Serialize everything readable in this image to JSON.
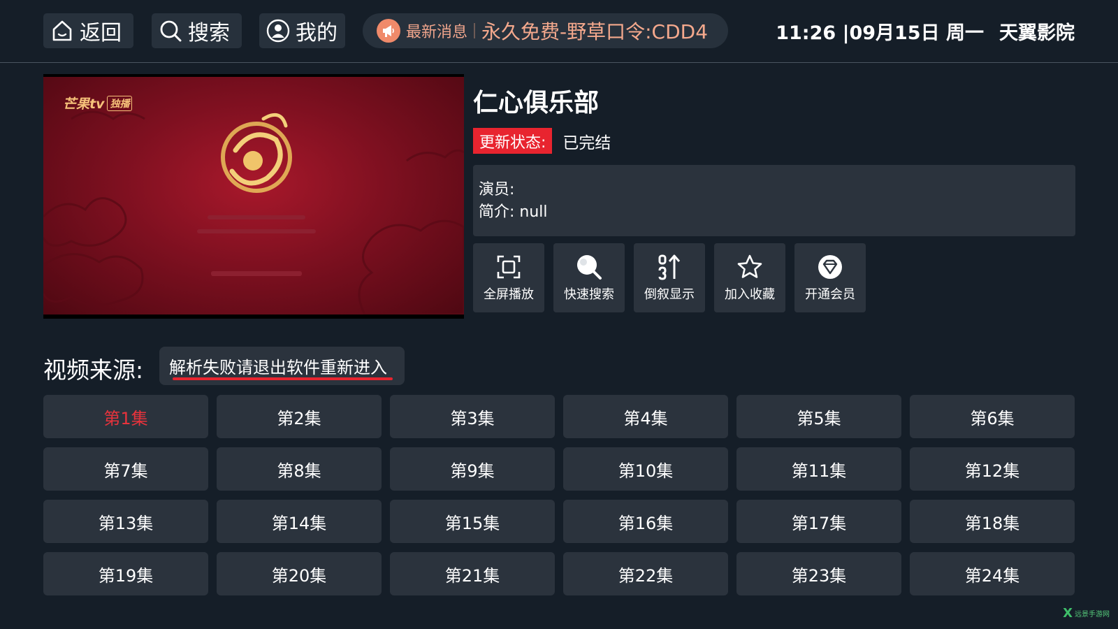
{
  "nav": {
    "back_label": "返回",
    "search_label": "搜索",
    "mine_label": "我的"
  },
  "news": {
    "label": "最新消息",
    "text": "永久免费-野草口令:CDD4"
  },
  "status_bar": {
    "datetime": "11:26 |09月15日 周一",
    "app_name": "天翼影院"
  },
  "poster": {
    "brand": "芒果tv",
    "badge": "独播"
  },
  "detail": {
    "title": "仁心俱乐部",
    "status_label": "更新状态:",
    "status_value": "已完结",
    "actors": "演员:",
    "intro": "简介:  null"
  },
  "actions": [
    {
      "label": "全屏播放",
      "icon": "fullscreen-icon"
    },
    {
      "label": "快速搜索",
      "icon": "search-icon"
    },
    {
      "label": "倒叙显示",
      "icon": "sort-icon"
    },
    {
      "label": "加入收藏",
      "icon": "star-icon"
    },
    {
      "label": "开通会员",
      "icon": "diamond-icon"
    }
  ],
  "source": {
    "label": "视频来源:",
    "value": "解析失败请退出软件重新进入"
  },
  "episodes": [
    "第1集",
    "第2集",
    "第3集",
    "第4集",
    "第5集",
    "第6集",
    "第7集",
    "第8集",
    "第9集",
    "第10集",
    "第11集",
    "第12集",
    "第13集",
    "第14集",
    "第15集",
    "第16集",
    "第17集",
    "第18集",
    "第19集",
    "第20集",
    "第21集",
    "第22集",
    "第23集",
    "第24集"
  ],
  "watermark": "远景手游网",
  "colors": {
    "background": "#151e28",
    "panel": "#2b333d",
    "accent_red": "#e8242f",
    "news_text": "#f5a98d"
  }
}
